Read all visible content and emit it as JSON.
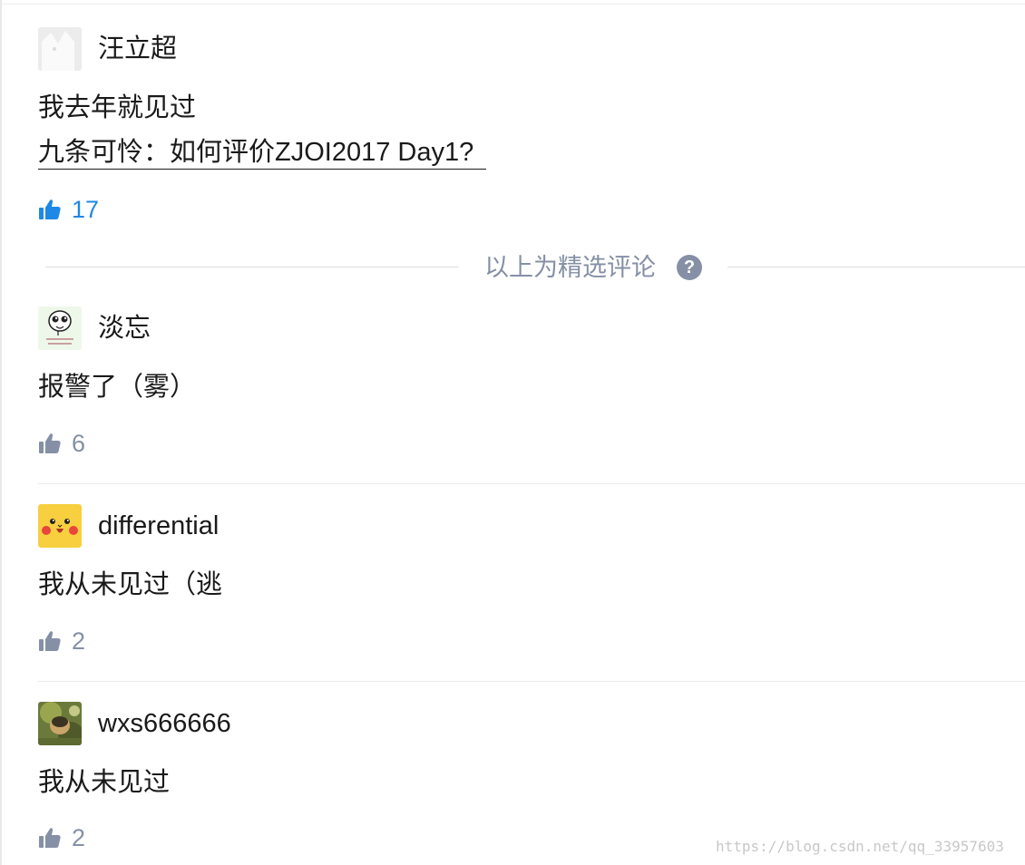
{
  "comments": [
    {
      "author": "汪立超",
      "avatar_icon": "default-avatar-icon",
      "text": "我去年就见过",
      "quote_link": "九条可怜：如何评价ZJOI2017 Day1?",
      "likes": "17",
      "liked": true
    },
    {
      "author": "淡忘",
      "avatar_icon": "cartoon-face-avatar-icon",
      "text": "报警了（雾）",
      "likes": "6",
      "liked": false
    },
    {
      "author": "differential",
      "avatar_icon": "pikachu-avatar-icon",
      "text": "我从未见过（逃",
      "likes": "2",
      "liked": false
    },
    {
      "author": "wxs666666",
      "avatar_icon": "photo-avatar-icon",
      "text": "我从未见过",
      "likes": "2",
      "liked": false
    }
  ],
  "featured_separator": {
    "label": "以上为精选评论",
    "help_icon": "question-circle-icon",
    "help_glyph": "?"
  },
  "watermark": "https://blog.csdn.net/qq_33957603",
  "colors": {
    "like_active": "#1e88e5",
    "like_inactive": "#8590a6",
    "text": "#1a1a1a"
  }
}
